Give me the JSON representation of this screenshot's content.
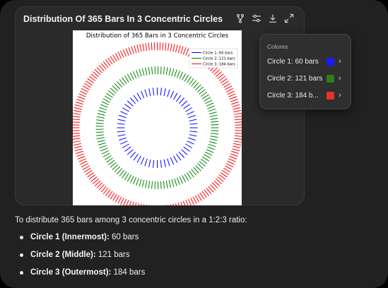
{
  "card": {
    "title": "Distribution Of 365 Bars In 3 Concentric Circles",
    "toolbar": [
      "fork-icon",
      "settings-sliders-icon",
      "download-icon",
      "expand-icon"
    ]
  },
  "chart_data": {
    "type": "scatter",
    "title": "Distribution of 365 Bars in 3 Concentric Circles",
    "legend_position": "top-right",
    "series": [
      {
        "name": "Circle 1: 60 bars",
        "count": 60,
        "color": "#0000ff"
      },
      {
        "name": "Circle 2: 121 bars",
        "count": 121,
        "color": "#008000"
      },
      {
        "name": "Circle 3: 184 bars",
        "count": 184,
        "color": "#ff0000"
      }
    ]
  },
  "panel": {
    "title": "Colores",
    "rows": [
      {
        "label": "Circle 1: 60 bars",
        "color": "#1a1aff"
      },
      {
        "label": "Circle 2: 121 bars",
        "color": "#2e7d1f"
      },
      {
        "label": "Circle 3: 184 b...",
        "color": "#e5332a"
      }
    ]
  },
  "message": {
    "intro": "To distribute 365 bars among 3 concentric circles in a 1:2:3 ratio:",
    "items": [
      {
        "label": "Circle 1 (Innermost):",
        "value": " 60 bars"
      },
      {
        "label": "Circle 2 (Middle):",
        "value": " 121 bars"
      },
      {
        "label": "Circle 3 (Outermost):",
        "value": " 184 bars"
      }
    ]
  }
}
